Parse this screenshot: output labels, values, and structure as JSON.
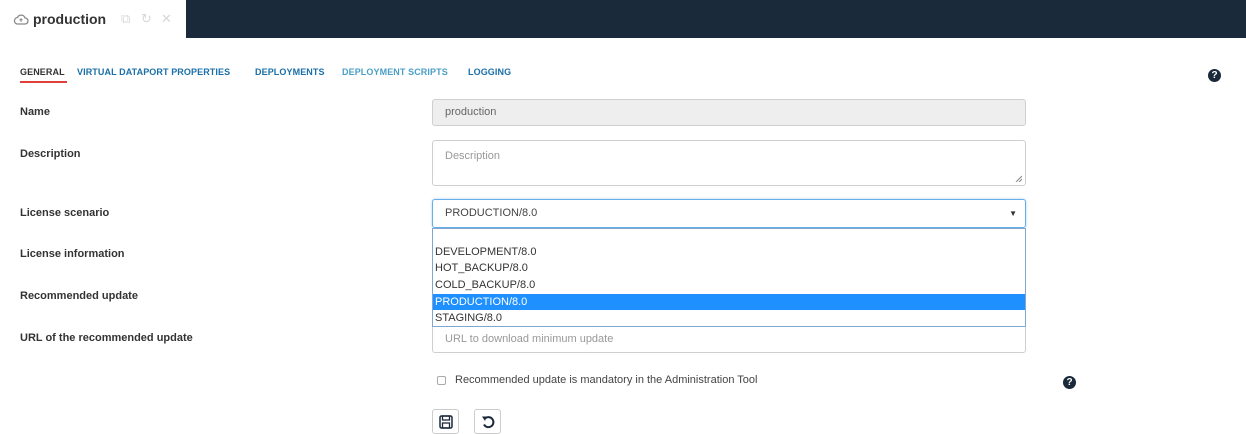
{
  "tab": {
    "title": "production",
    "icons": [
      "cloud-icon",
      "copy-icon",
      "refresh-icon",
      "close-icon"
    ]
  },
  "subtabs": [
    {
      "label": "GENERAL",
      "active": true
    },
    {
      "label": "VIRTUAL DATAPORT PROPERTIES",
      "active": false
    },
    {
      "label": "DEPLOYMENTS",
      "active": false
    },
    {
      "label": "DEPLOYMENT SCRIPTS",
      "active": false
    },
    {
      "label": "LOGGING",
      "active": false
    }
  ],
  "help_icon": "question-circle-icon",
  "form": {
    "name": {
      "label": "Name",
      "value": "production"
    },
    "description": {
      "label": "Description",
      "placeholder": "Description"
    },
    "license_scenario": {
      "label": "License scenario",
      "selected": "PRODUCTION/8.0",
      "options": [
        "DEVELOPMENT/8.0",
        "HOT_BACKUP/8.0",
        "COLD_BACKUP/8.0",
        "PRODUCTION/8.0",
        "STAGING/8.0"
      ]
    },
    "license_information": {
      "label": "License information"
    },
    "recommended_update": {
      "label": "Recommended update"
    },
    "recommended_update_url": {
      "label": "URL of the recommended update",
      "placeholder": "URL to download minimum update"
    },
    "mandatory_checkbox": {
      "label": "Recommended update is mandatory in the Administration Tool",
      "checked": false
    }
  },
  "buttons": [
    "save-icon",
    "undo-icon"
  ],
  "colors": {
    "topbar": "#1b2a3a",
    "link": "#1a6fa8",
    "active_underline": "#e0403a",
    "selected_option": "#1e90ff"
  }
}
